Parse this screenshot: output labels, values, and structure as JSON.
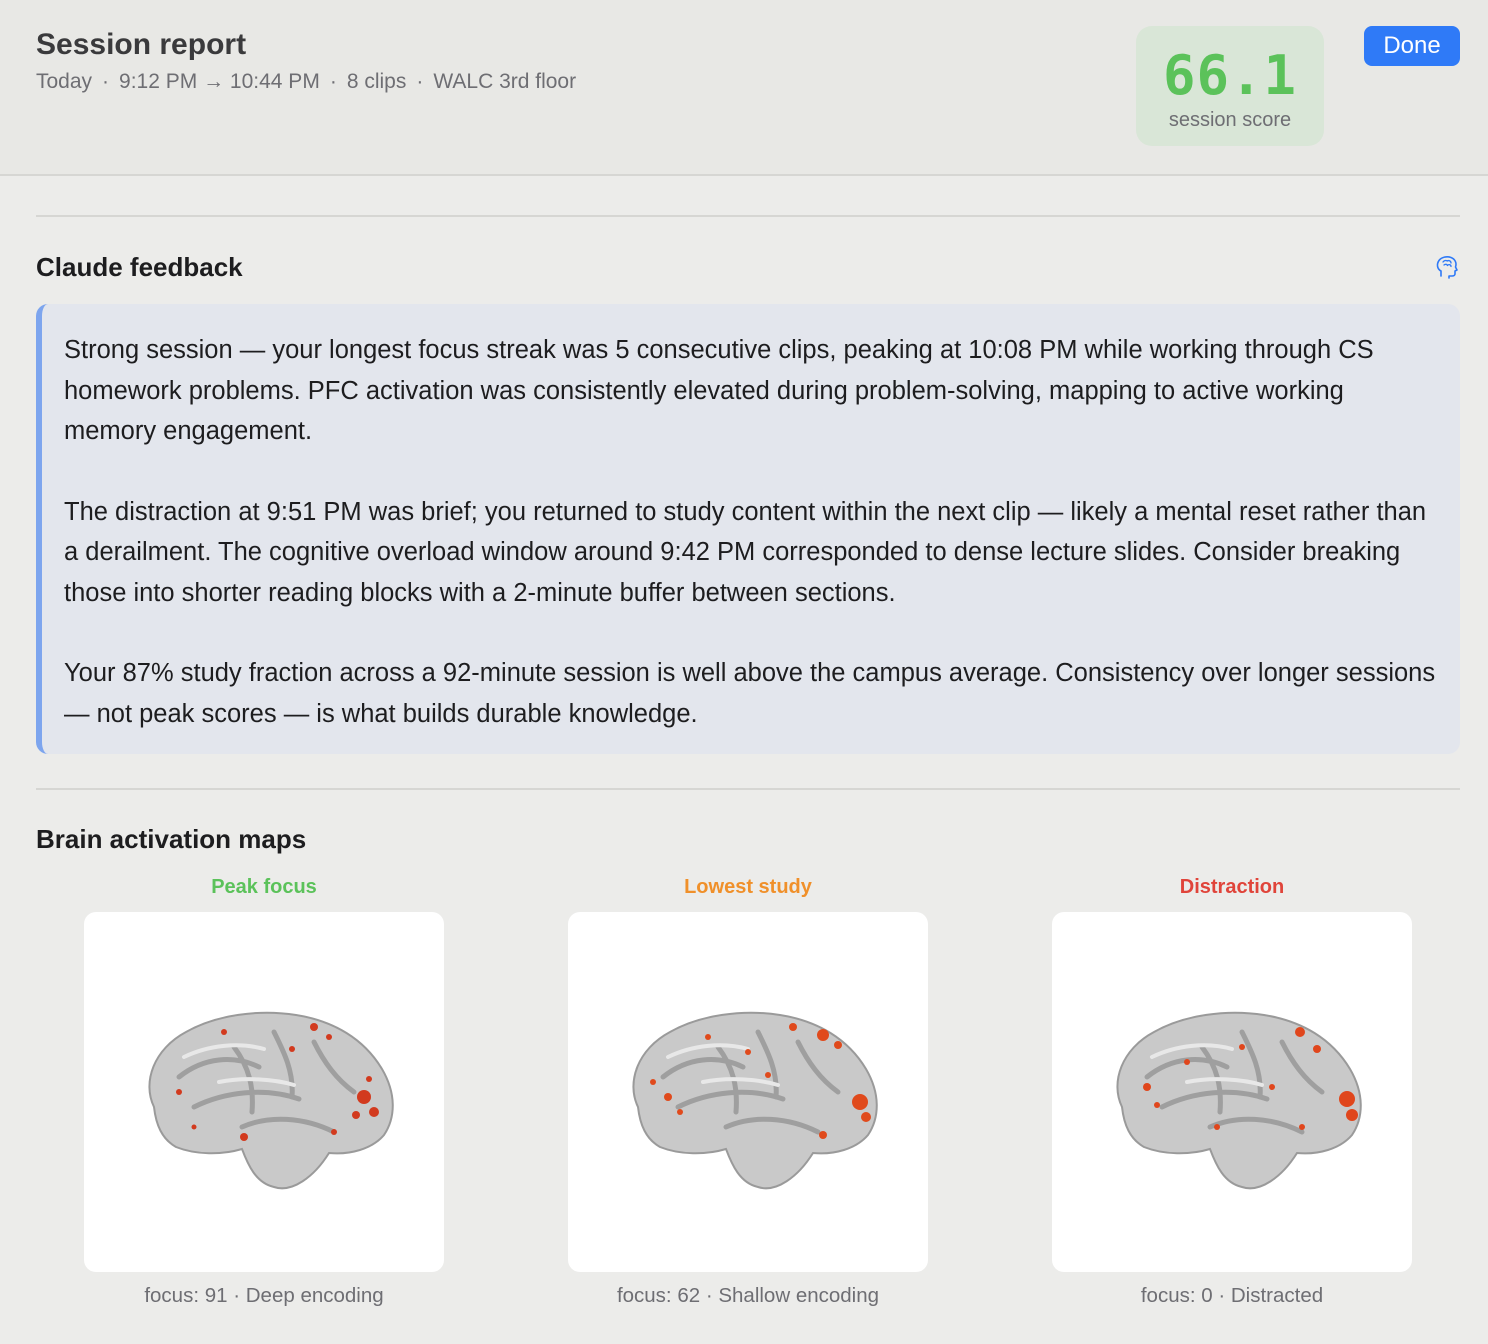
{
  "header": {
    "title": "Session report",
    "meta": [
      "Today",
      "9:12 PM → 10:44 PM",
      "8 clips",
      "WALC 3rd floor"
    ],
    "separator": "·",
    "score": {
      "value": "66.1",
      "label": "session score",
      "color": "#5bc25a"
    },
    "done_label": "Done"
  },
  "feedback": {
    "title": "Claude feedback",
    "icon": "brain-icon",
    "paragraphs": [
      "Strong session — your longest focus streak was 5 consecutive clips, peaking at 10:08 PM while working through CS homework problems. PFC activation was consistently elevated during problem-solving, mapping to active working memory engagement.",
      "The distraction at 9:51 PM was brief; you returned to study content within the next clip — likely a mental reset rather than a derailment. The cognitive overload window around 9:42 PM corresponded to dense lecture slides. Consider breaking those into shorter reading blocks with a 2-minute buffer between sections.",
      "Your 87% study fraction across a 92-minute session is well above the campus average. Consistency over longer sessions — not peak scores — is what builds durable knowledge."
    ]
  },
  "brain_maps": {
    "title": "Brain activation maps",
    "items": [
      {
        "label": "Peak focus",
        "color": "#5bc25a",
        "caption": "focus: 91 · Deep encoding"
      },
      {
        "label": "Lowest study",
        "color": "#f0902a",
        "caption": "focus: 62 · Shallow encoding"
      },
      {
        "label": "Distraction",
        "color": "#e0443a",
        "caption": "focus: 0 · Distracted"
      }
    ]
  }
}
